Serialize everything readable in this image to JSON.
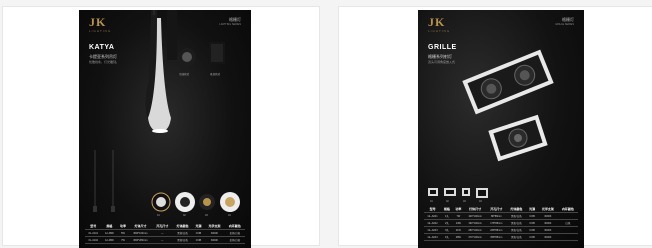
{
  "brand": {
    "logo": "JK",
    "logo_sub": "LIGHTING"
  },
  "cards": [
    {
      "tag": "格栅灯",
      "tag_sub": "LIGHTING SERIES",
      "title": "KATYA",
      "subtitle": "卡提亚系列吊灯",
      "subtitle2": "优雅线条，灯光雕刻。",
      "product_labels": [
        "吊线款式",
        "吸顶款式"
      ],
      "variant_labels": [
        "01",
        "02",
        "03",
        "04"
      ],
      "table": {
        "headers": [
          "型号",
          "规格",
          "功率",
          "灯体尺寸",
          "开孔尺寸",
          "灯体颜色",
          "光源",
          "光学支架",
          "内环颜色"
        ],
        "rows": [
          [
            "KL-0101",
            "12-48W",
            "5W",
            "Φ60*160mm",
            "—",
            "黑色/白色",
            "COB",
            "3000K",
            "金色/白色"
          ],
          [
            "KL-0102",
            "12-48W",
            "7W",
            "Φ60*280mm",
            "—",
            "黑色/白色",
            "COB",
            "3000K",
            "金色/白色"
          ]
        ]
      }
    },
    {
      "tag": "格栅灯",
      "tag_sub": "GRILLE SERIES",
      "title": "GRILLE",
      "subtitle": "格栅系列射灯",
      "subtitle2": "双头可调角度嵌入式",
      "variant_labels": [
        "01",
        "02",
        "03",
        "04"
      ],
      "table": {
        "headers": [
          "型号",
          "规格",
          "功率",
          "灯体尺寸",
          "开孔尺寸",
          "灯体颜色",
          "光源",
          "光学支架",
          "内环颜色"
        ],
        "rows": [
          [
            "GL-A001",
            "1头",
            "7W",
            "100*100mm",
            "88*88mm",
            "黑色/白色",
            "COB",
            "3000K",
            ""
          ],
          [
            "GL-A002",
            "2头",
            "14W",
            "190*100mm",
            "178*88mm",
            "黑色/白色",
            "COB",
            "3000K",
            "白色"
          ],
          [
            "GL-A003",
            "3头",
            "21W",
            "280*100mm",
            "268*88mm",
            "黑色/白色",
            "COB",
            "3000K",
            ""
          ],
          [
            "GL-A004",
            "4头",
            "28W",
            "370*100mm",
            "358*88mm",
            "黑色/白色",
            "COB",
            "3000K",
            ""
          ]
        ]
      }
    }
  ],
  "colors": {
    "gold": "#b8944a",
    "page_bg": "#0f0f0f",
    "card_bg": "#ffffff",
    "body_bg": "#f4f4f5"
  }
}
